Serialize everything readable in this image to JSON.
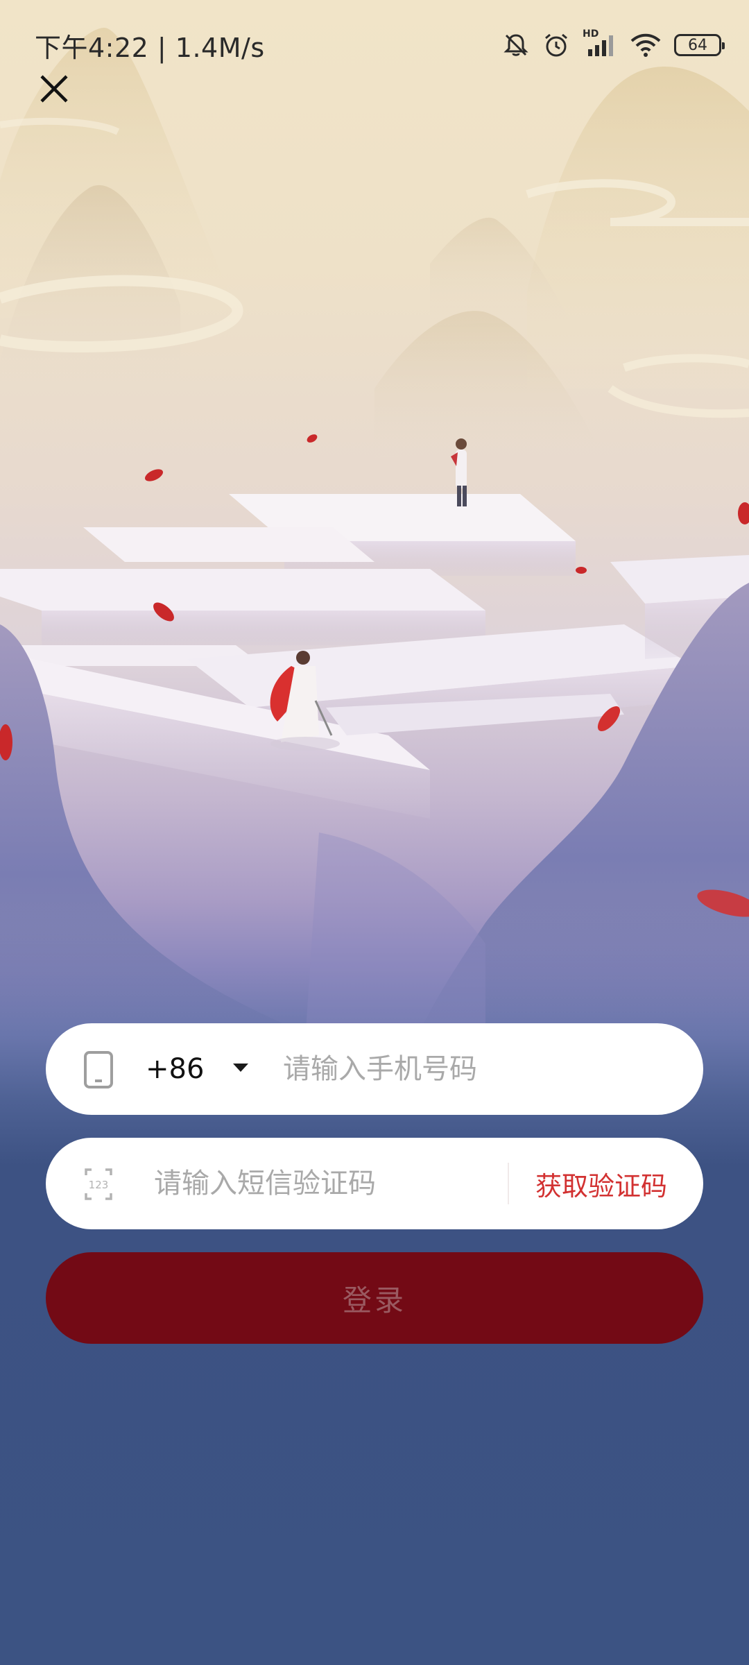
{
  "status_bar": {
    "time": "下午4:22 | 1.4M/s",
    "network_badge": "HD",
    "battery": "64",
    "icons": [
      "bell-muted-icon",
      "alarm-icon",
      "signal-icon",
      "wifi-icon",
      "battery-icon"
    ]
  },
  "toolbar": {
    "close_icon": "close-icon"
  },
  "login_form": {
    "phone": {
      "icon": "phone-icon",
      "country_code": "+86",
      "placeholder": "请输入手机号码",
      "value": ""
    },
    "sms_code": {
      "icon": "keypad-123-icon",
      "placeholder": "请输入短信验证码",
      "value": "",
      "get_code_label": "获取验证码"
    },
    "login_label": "登录"
  },
  "colors": {
    "accent_red": "#d23131",
    "login_button": "#730a15",
    "bottom_background": "#3c5383"
  }
}
